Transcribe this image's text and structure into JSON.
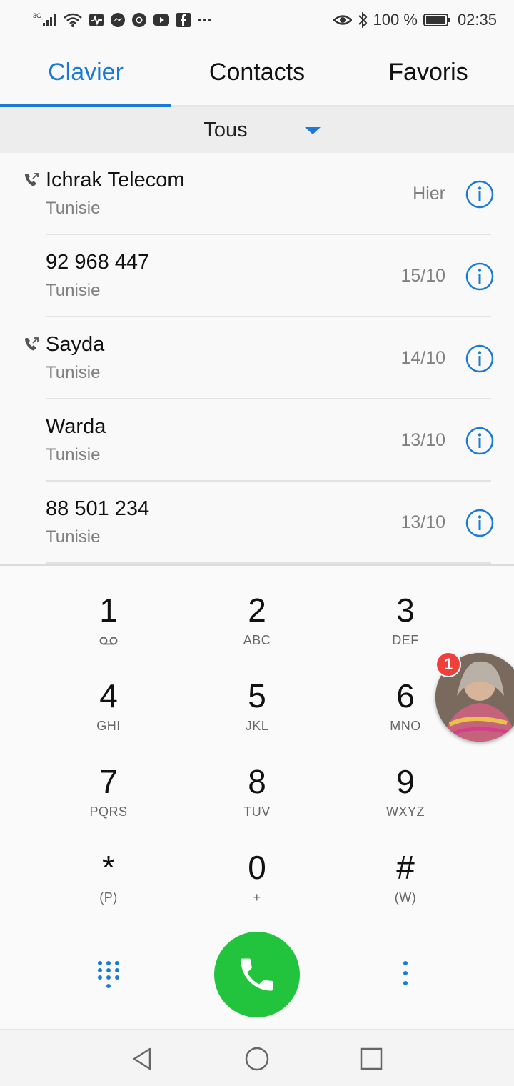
{
  "status_bar": {
    "network": "3G",
    "battery": "100 %",
    "time": "02:35",
    "icons": [
      "signal-icon",
      "wifi-icon",
      "activity-icon",
      "messenger-icon",
      "chrome-icon",
      "youtube-icon",
      "facebook-icon",
      "more-dots-icon",
      "eye-icon",
      "bluetooth-icon",
      "battery-icon"
    ]
  },
  "tabs": [
    {
      "label": "Clavier",
      "active": true
    },
    {
      "label": "Contacts",
      "active": false
    },
    {
      "label": "Favoris",
      "active": false
    }
  ],
  "filter": {
    "label": "Tous"
  },
  "calls": [
    {
      "name": "Ichrak Telecom",
      "country": "Tunisie",
      "date": "Hier",
      "outgoing_icon": true
    },
    {
      "name": "92 968 447",
      "country": "Tunisie",
      "date": "15/10",
      "outgoing_icon": false
    },
    {
      "name": "Sayda",
      "country": "Tunisie",
      "date": "14/10",
      "outgoing_icon": true
    },
    {
      "name": "Warda",
      "country": "Tunisie",
      "date": "13/10",
      "outgoing_icon": false
    },
    {
      "name": "88 501 234",
      "country": "Tunisie",
      "date": "13/10",
      "outgoing_icon": false
    }
  ],
  "dialpad": {
    "keys": [
      {
        "digit": "1",
        "sub": ""
      },
      {
        "digit": "2",
        "sub": "ABC"
      },
      {
        "digit": "3",
        "sub": "DEF"
      },
      {
        "digit": "4",
        "sub": "GHI"
      },
      {
        "digit": "5",
        "sub": "JKL"
      },
      {
        "digit": "6",
        "sub": "MNO"
      },
      {
        "digit": "7",
        "sub": "PQRS"
      },
      {
        "digit": "8",
        "sub": "TUV"
      },
      {
        "digit": "9",
        "sub": "WXYZ"
      },
      {
        "digit": "*",
        "sub": "(P)"
      },
      {
        "digit": "0",
        "sub": "+"
      },
      {
        "digit": "#",
        "sub": "(W)"
      }
    ]
  },
  "chathead": {
    "badge": "1"
  },
  "colors": {
    "accent": "#1a7ad6",
    "call_green": "#22c43e",
    "badge_red": "#f0403c"
  }
}
